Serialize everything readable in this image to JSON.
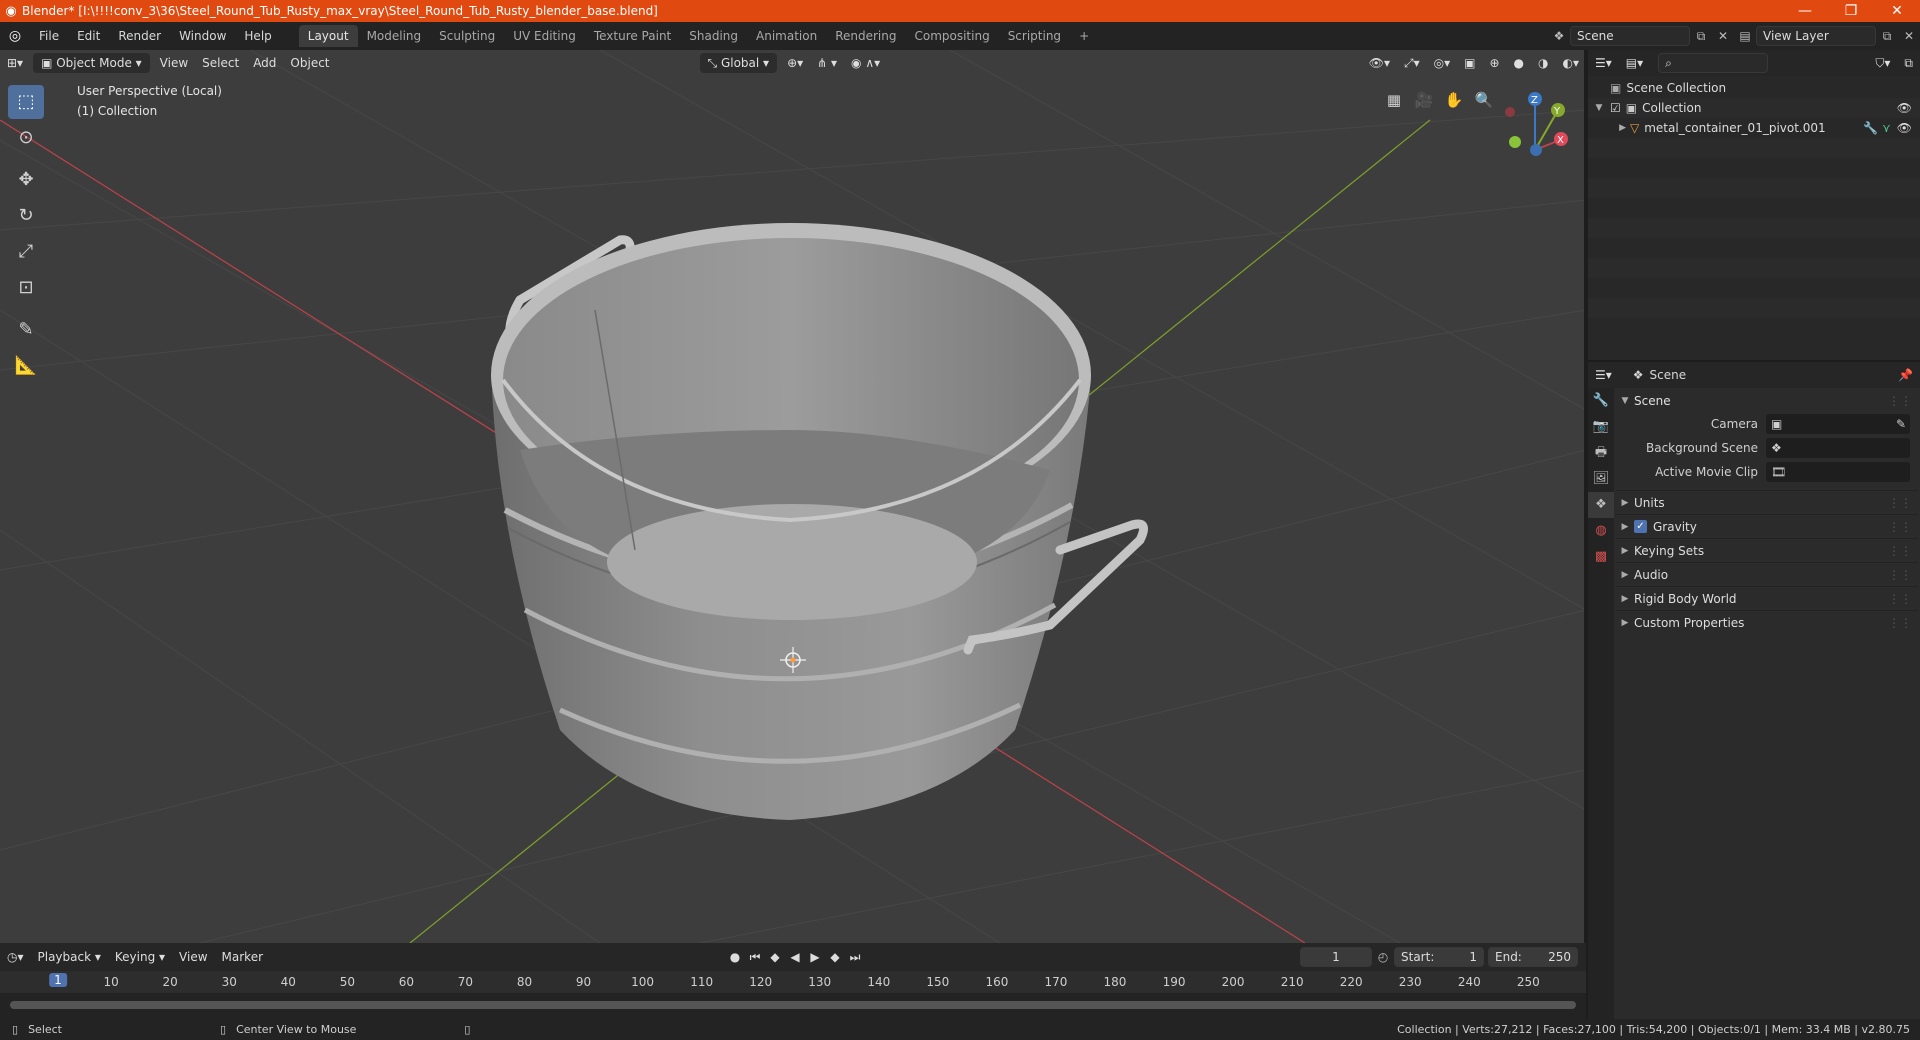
{
  "window": {
    "title": "Blender* [I:\\!!!!conv_3\\36\\Steel_Round_Tub_Rusty_max_vray\\Steel_Round_Tub_Rusty_blender_base.blend]",
    "minimize": "—",
    "restore": "❐",
    "close": "✕"
  },
  "menu": [
    "File",
    "Edit",
    "Render",
    "Window",
    "Help"
  ],
  "workspaces": [
    "Layout",
    "Modeling",
    "Sculpting",
    "UV Editing",
    "Texture Paint",
    "Shading",
    "Animation",
    "Rendering",
    "Compositing",
    "Scripting"
  ],
  "workspace_add": "+",
  "scene_selector": {
    "value": "Scene"
  },
  "view_layer_selector": {
    "value": "View Layer"
  },
  "viewport": {
    "mode": "Object Mode",
    "menus": [
      "View",
      "Select",
      "Add",
      "Object"
    ],
    "orientation": "Global",
    "overlay_text_line1": "User Perspective (Local)",
    "overlay_text_line2": "(1) Collection",
    "gizmo_labels": {
      "z": "Z",
      "y": "Y",
      "x": "X"
    },
    "colors": {
      "background": "#3d3d3d",
      "axis_x": "#c0424b",
      "axis_y": "#7ea02a",
      "accent": "#4f73b0"
    }
  },
  "timeline": {
    "menus": [
      "Playback",
      "Keying",
      "View",
      "Marker"
    ],
    "current_frame": "1",
    "start_label": "Start:",
    "start_value": "1",
    "end_label": "End:",
    "end_value": "250",
    "ruler_ticks": [
      "10",
      "20",
      "30",
      "40",
      "50",
      "60",
      "70",
      "80",
      "90",
      "100",
      "110",
      "120",
      "130",
      "140",
      "150",
      "160",
      "170",
      "180",
      "190",
      "200",
      "210",
      "220",
      "230",
      "240",
      "250"
    ],
    "ruler_current": "1"
  },
  "statusbar": {
    "left_action": "Select",
    "middle_action": "Center View to Mouse",
    "stats": "Collection | Verts:27,212 | Faces:27,100 | Tris:54,200 | Objects:0/1 | Mem: 33.4 MB | v2.80.75"
  },
  "outliner": {
    "root": "Scene Collection",
    "collection": "Collection",
    "object": "metal_container_01_pivot.001"
  },
  "properties": {
    "header_title": "Scene",
    "panel_title": "Scene",
    "camera_label": "Camera",
    "background_scene_label": "Background Scene",
    "active_movie_clip_label": "Active Movie Clip",
    "subpanels": [
      "Units",
      "Gravity",
      "Keying Sets",
      "Audio",
      "Rigid Body World",
      "Custom Properties"
    ]
  }
}
